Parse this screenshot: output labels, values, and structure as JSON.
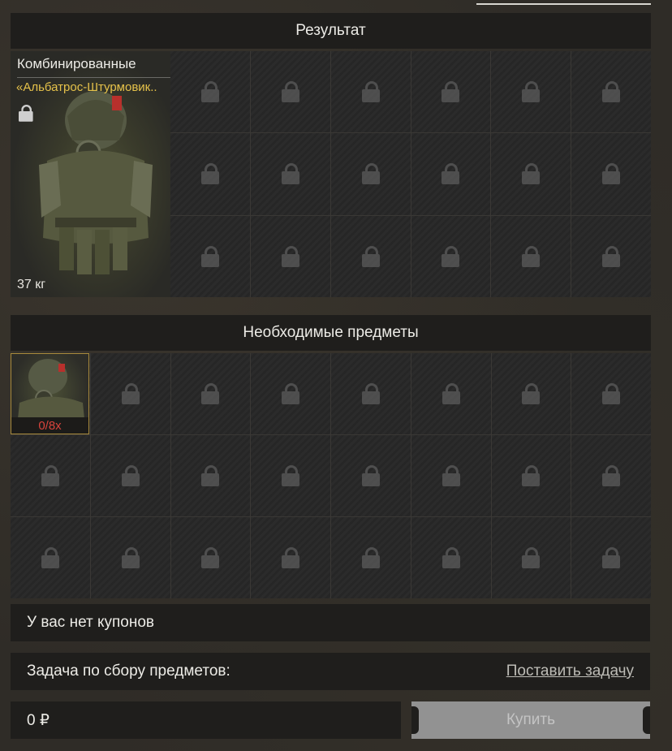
{
  "result": {
    "header": "Результат",
    "item": {
      "category": "Комбинированные",
      "name": "«Альбатрос-Штурмовик..",
      "weight": "37 кг",
      "icon": "armor-suit-icon"
    }
  },
  "required": {
    "header": "Необходимые предметы",
    "item": {
      "count": "0/8х",
      "icon": "armor-suit-icon"
    }
  },
  "coupons": {
    "text": "У вас нет купонов"
  },
  "task": {
    "label": "Задача по сбору предметов:",
    "link": "Поставить задачу"
  },
  "price": {
    "value": "0 ₽"
  },
  "buy": {
    "label": "Купить"
  },
  "colors": {
    "accent_name": "#e6c24a",
    "count_red": "#d9443c"
  }
}
